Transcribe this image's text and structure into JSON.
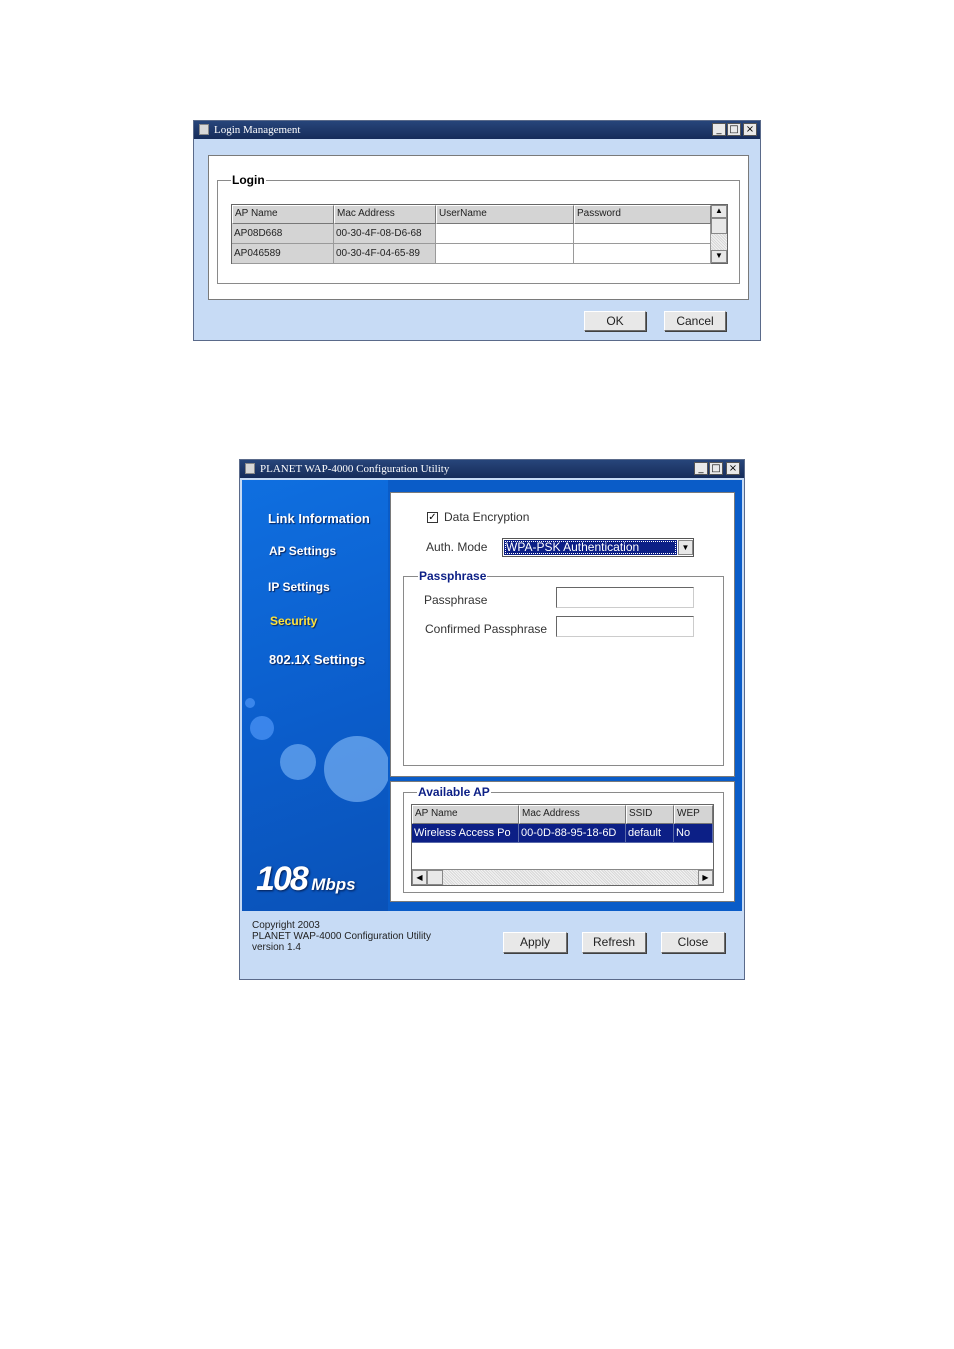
{
  "login_window": {
    "title": "Login Management",
    "group_label": "Login",
    "columns": [
      "AP Name",
      "Mac Address",
      "UserName",
      "Password"
    ],
    "rows": [
      [
        "AP08D668",
        "00-30-4F-08-D6-68",
        "",
        ""
      ],
      [
        "AP046589",
        "00-30-4F-04-65-89",
        "",
        ""
      ]
    ],
    "ok_label": "OK",
    "cancel_label": "Cancel"
  },
  "config_window": {
    "title": "PLANET WAP-4000 Configuration Utility",
    "nav": [
      "Link Information",
      "AP Settings",
      "IP Settings",
      "Security",
      "802.1X Settings"
    ],
    "brand_number": "108",
    "brand_unit": "Mbps",
    "security": {
      "data_encryption_label": "Data Encryption",
      "auth_mode_label": "Auth. Mode",
      "auth_mode_value": "WPA-PSK Authentication",
      "passphrase_group": "Passphrase",
      "passphrase_label": "Passphrase",
      "confirmed_label": "Confirmed Passphrase"
    },
    "available_ap": {
      "group_label": "Available AP",
      "columns": [
        "AP Name",
        "Mac Address",
        "SSID",
        "WEP"
      ],
      "rows": [
        [
          "Wireless Access Po",
          "00-0D-88-95-18-6D",
          "default",
          "No"
        ]
      ]
    },
    "footer": {
      "copyright": "Copyright 2003",
      "product": "PLANET WAP-4000 Configuration Utility",
      "version": "version 1.4"
    },
    "apply_label": "Apply",
    "refresh_label": "Refresh",
    "close_label": "Close"
  },
  "colors": {
    "title_bar": "#1f3a6e",
    "dialog_bg": "#c7dbf5",
    "sidebar_blue": "#0c64d6",
    "selection": "#0c1f86",
    "nav_active": "#ffe23a"
  }
}
